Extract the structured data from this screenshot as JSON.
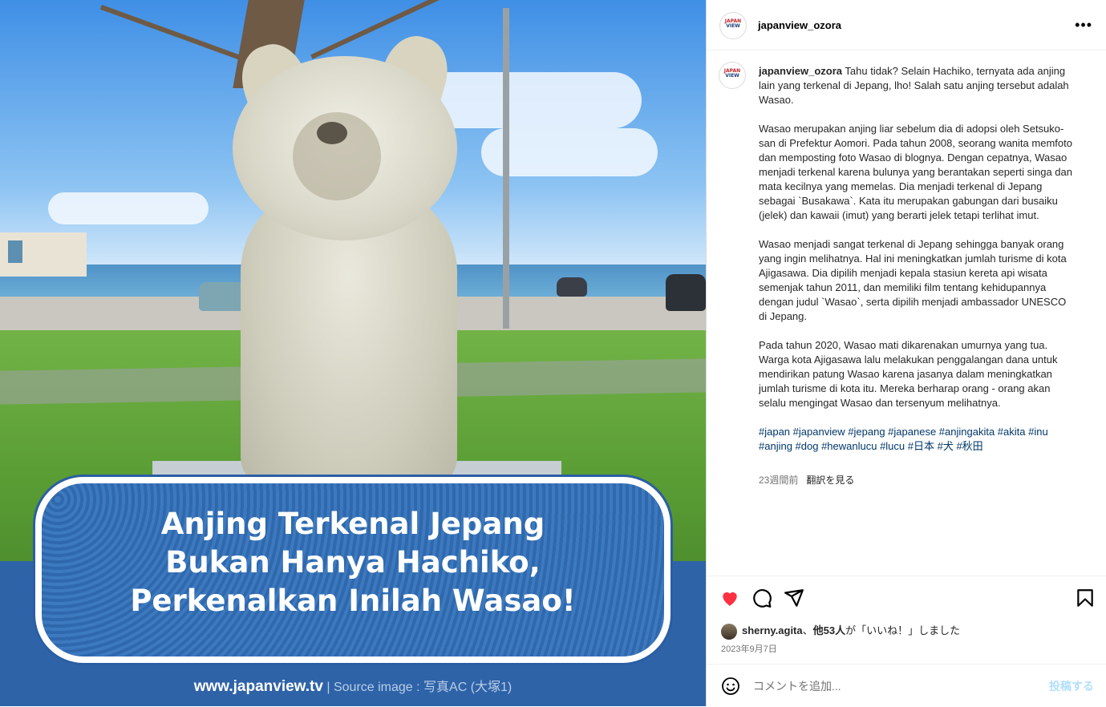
{
  "post": {
    "username": "japanview_ozora",
    "logo_text_top": "JAPAN",
    "logo_text_bottom": "VIEW",
    "more_label": "•••"
  },
  "image": {
    "title_lines": [
      "Anjing Terkenal Jepang",
      "Bukan Hanya Hachiko,",
      "Perkenalkan Inilah Wasao!"
    ],
    "site": "www.japanview.tv",
    "source": " | Source image : 写真AC (大塚1)"
  },
  "caption": {
    "username": "japanview_ozora",
    "p1": " Tahu tidak? Selain Hachiko, ternyata ada anjing lain yang terkenal di Jepang, lho! Salah satu anjing tersebut adalah Wasao.",
    "p2": "Wasao merupakan anjing liar sebelum dia di adopsi oleh Setsuko-san di Prefektur Aomori. Pada tahun 2008, seorang wanita memfoto dan memposting foto Wasao di blognya. Dengan cepatnya, Wasao menjadi terkenal karena bulunya yang berantakan seperti singa dan mata kecilnya yang memelas. Dia menjadi terkenal di Jepang sebagai `Busakawa`. Kata itu merupakan gabungan dari busaiku (jelek) dan kawaii (imut) yang berarti jelek tetapi terlihat imut.",
    "p3": "Wasao menjadi sangat terkenal di Jepang sehingga banyak orang yang ingin melihatnya. Hal ini meningkatkan jumlah turisme di kota Ajigasawa. Dia dipilih menjadi kepala stasiun kereta api wisata semenjak tahun 2011, dan memiliki film tentang kehidupannya dengan judul `Wasao`, serta dipilih menjadi ambassador UNESCO di Jepang.",
    "p4": "Pada tahun 2020, Wasao mati dikarenakan umurnya yang tua. Warga kota Ajigasawa lalu melakukan penggalangan dana untuk mendirikan patung Wasao karena jasanya dalam meningkatkan jumlah turisme di kota itu. Mereka berharap orang - orang akan selalu mengingat Wasao dan tersenyum melihatnya.",
    "hashtags": "#japan #japanview #jepang #japanese #anjingakita #akita #inu #anjing #dog #hewanlucu #lucu #日本 #犬 #秋田",
    "time": "23週間前",
    "translate": "翻訳を見る"
  },
  "actions": {
    "liked_by_user": "sherny.agita",
    "liked_by_rest": "、他53人が「いいね！」しました",
    "liked_by_rest_bold": "他53人",
    "date": "2023年9月7日",
    "like_color": "#ff3040"
  },
  "comment": {
    "placeholder": "コメントを追加...",
    "post_label": "投稿する"
  }
}
